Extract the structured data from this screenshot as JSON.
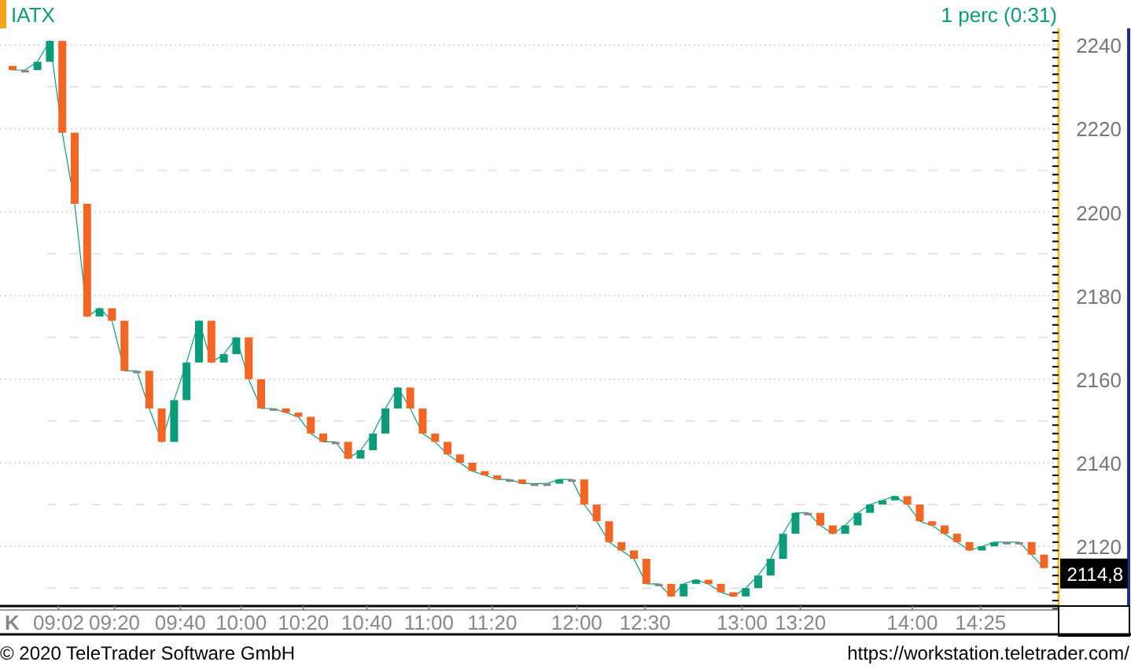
{
  "header": {
    "interval": "1 perc (0:31)"
  },
  "chart": {
    "axis_marker": "K",
    "last_price": "2114,8",
    "time_labels": [
      "09:02",
      "09:20",
      "09:40",
      "10:00",
      "10:20",
      "10:40",
      "11:00",
      "11:20",
      "12:00",
      "12:30",
      "13:00",
      "13:20",
      "14:00",
      "14:25"
    ],
    "chart_data": {
      "type": "line",
      "grid": true,
      "ylim": [
        2105.7,
        2244
      ],
      "yticks": [
        2120,
        2140,
        2160,
        2180,
        2200,
        2220,
        2240
      ],
      "series": [
        {
          "name": "IATX",
          "color": "#0a9b7a",
          "values": [
            2234,
            2234,
            2236,
            2241,
            2219,
            2202,
            2175,
            2177,
            2174,
            2162,
            2162,
            2153,
            2145,
            2155,
            2164,
            2174,
            2164,
            2166,
            2170,
            2160,
            2153,
            2153,
            2152,
            2151,
            2147,
            2145,
            2145,
            2141,
            2143,
            2147,
            2153,
            2158,
            2153,
            2147,
            2145,
            2142,
            2140,
            2138,
            2137,
            2136,
            2136,
            2135,
            2135,
            2135,
            2136,
            2136,
            2130,
            2126,
            2121,
            2119,
            2117,
            2111,
            2111,
            2108,
            2111,
            2112,
            2111,
            2109,
            2108,
            2110,
            2113,
            2117,
            2123,
            2128,
            2128,
            2125,
            2123,
            2125,
            2128,
            2130,
            2131,
            2132,
            2130,
            2126,
            2125,
            2123,
            2121,
            2119,
            2120,
            2121,
            2121,
            2121,
            2118,
            2114.8
          ]
        }
      ]
    }
  },
  "footer": {
    "copyright": "© 2020 TeleTrader Software GmbH",
    "url": "https://workstation.teletrader.com/"
  }
}
